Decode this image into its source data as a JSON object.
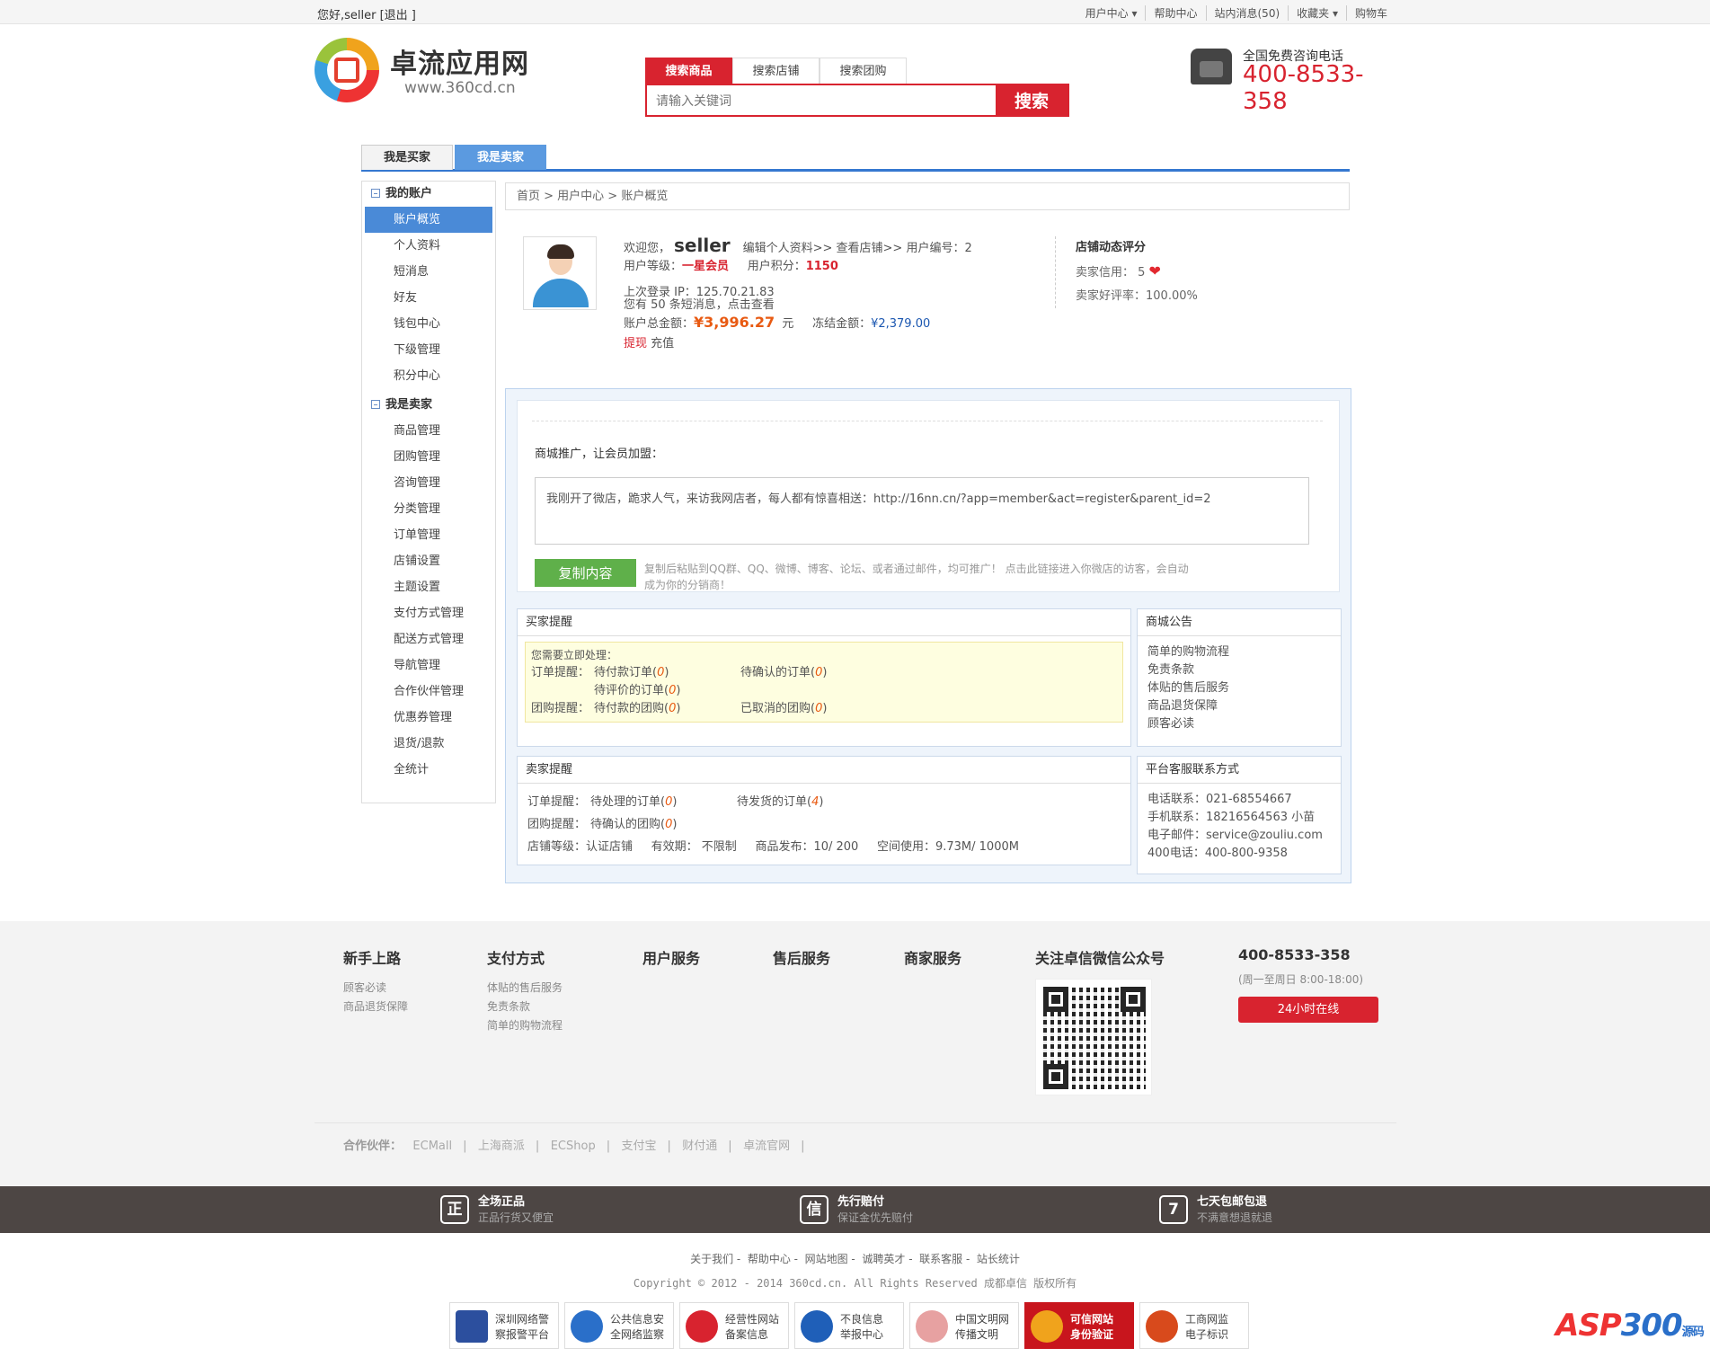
{
  "topbar": {
    "greeting": "您好,seller [退出 ]",
    "links": [
      "用户中心 ▾",
      "帮助中心",
      "站内消息(50)",
      "收藏夹 ▾",
      "购物车"
    ]
  },
  "logo": {
    "name": "卓流应用网",
    "url": "www.360cd.cn"
  },
  "search": {
    "tabs": [
      "搜索商品",
      "搜索店铺",
      "搜索团购"
    ],
    "placeholder": "请输入关键词",
    "button": "搜索"
  },
  "hotline": {
    "label": "全国免费咨询电话",
    "number": "400-8533-358"
  },
  "role_tabs": {
    "buyer": "我是买家",
    "seller": "我是卖家"
  },
  "sidebar": {
    "group1": "我的账户",
    "items1": [
      "账户概览",
      "个人资料",
      "短消息",
      "好友",
      "钱包中心",
      "下级管理",
      "积分中心"
    ],
    "group2": "我是卖家",
    "items2": [
      "商品管理",
      "团购管理",
      "咨询管理",
      "分类管理",
      "订单管理",
      "店铺设置",
      "主题设置",
      "支付方式管理",
      "配送方式管理",
      "导航管理",
      "合作伙伴管理",
      "优惠券管理",
      "退货/退款",
      "全统计"
    ]
  },
  "breadcrumb": "首页 > 用户中心 > 账户概览",
  "profile": {
    "welcome": "欢迎您，",
    "username": "seller",
    "links": "编辑个人资料>>  查看店铺>>  用户编号：2",
    "level_label": "用户等级：",
    "level": "一星会员",
    "points_label": "用户积分：",
    "points": "1150",
    "last_ip": "上次登录 IP：125.70.21.83",
    "messages": "您有 50 条短消息，点击查看",
    "balance_label": "账户总金额：",
    "balance": "¥3,996.27",
    "balance_unit": "元",
    "frozen_label": "冻结金额：",
    "frozen": "¥2,379.00",
    "withdraw": "提现",
    "recharge": "充值"
  },
  "store_rating": {
    "title": "店铺动态评分",
    "credit": "卖家信用： 5",
    "rate": "卖家好评率：100.00%"
  },
  "promo": {
    "label": "商城推广，让会员加盟：",
    "text": "我刚开了微店，跪求人气，来访我网店者，每人都有惊喜相送：http://16nn.cn/?app=member&act=register&parent_id=2",
    "copy_button": "复制内容",
    "hint": "复制后粘贴到QQ群、QQ、微博、博客、论坛、或者通过邮件，均可推广！ 点击此链接进入你微店的访客，会自动成为你的分销商！"
  },
  "buyer_panel": {
    "title": "买家提醒",
    "need": "您需要立即处理：",
    "order_label": "订单提醒：",
    "o1": "待付款订单",
    "o2": "待确认的订单",
    "o3": "待评价的订单",
    "group_label": "团购提醒：",
    "g1": "待付款的团购",
    "g2": "已取消的团购",
    "zero": "0"
  },
  "seller_panel": {
    "title": "卖家提醒",
    "order_label": "订单提醒：",
    "o1": "待处理的订单",
    "o1v": "0",
    "o2": "待发货的订单",
    "o2v": "4",
    "group_label": "团购提醒：",
    "g1": "待确认的团购",
    "g1v": "0",
    "stats": "店铺等级：认证店铺     有效期： 不限制     商品发布：10/ 200     空间使用：9.73M/ 1000M"
  },
  "notice": {
    "title": "商城公告",
    "items": [
      "简单的购物流程",
      "免责条款",
      "体贴的售后服务",
      "商品退货保障",
      "顾客必读"
    ]
  },
  "contact": {
    "title": "平台客服联系方式",
    "items": [
      "电话联系：021-68554667",
      "手机联系：18216564563 小苗",
      "电子邮件：service@zouliu.com",
      "400电话：400-800-9358"
    ]
  },
  "footer": {
    "cols": [
      {
        "title": "新手上路",
        "links": [
          "顾客必读",
          "商品退货保障"
        ]
      },
      {
        "title": "支付方式",
        "links": [
          "体贴的售后服务",
          "免责条款",
          "简单的购物流程"
        ]
      },
      {
        "title": "用户服务",
        "links": []
      },
      {
        "title": "售后服务",
        "links": []
      },
      {
        "title": "商家服务",
        "links": []
      }
    ],
    "wechat_title": "关注卓信微信公众号",
    "phone": "400-8533-358",
    "hours": "(周一至周日 8:00-18:00)",
    "online": "24小时在线",
    "partners_label": "合作伙伴：",
    "partners": [
      "ECMall",
      "上海商派",
      "ECShop",
      "支付宝",
      "财付通",
      "卓流官网"
    ]
  },
  "guarantees": [
    {
      "icon": "正",
      "title": "全场正品",
      "sub": "正品行货又便宜"
    },
    {
      "icon": "信",
      "title": "先行赔付",
      "sub": "保证金优先赔付"
    },
    {
      "icon": "7",
      "title": "七天包邮包退",
      "sub": "不满意想退就退"
    }
  ],
  "bottom": {
    "links": "关于我们 -  帮助中心 -  网站地图 -  诚聘英才 -  联系客服 -  站长统计",
    "copyright": "Copyright © 2012 - 2014 360cd.cn. All Rights Reserved 成都卓信 版权所有"
  },
  "badges": [
    [
      "深圳网络警",
      "察报警平台"
    ],
    [
      "公共信息安",
      "全网络监察"
    ],
    [
      "经营性网站",
      "备案信息"
    ],
    [
      "不良信息",
      "举报中心"
    ],
    [
      "中国文明网",
      "传播文明"
    ],
    [
      "可信网站",
      "身份验证"
    ],
    [
      "工商网监",
      "电子标识"
    ]
  ],
  "watermark": {
    "a": "ASP",
    "b": "300",
    "c": "源码"
  }
}
